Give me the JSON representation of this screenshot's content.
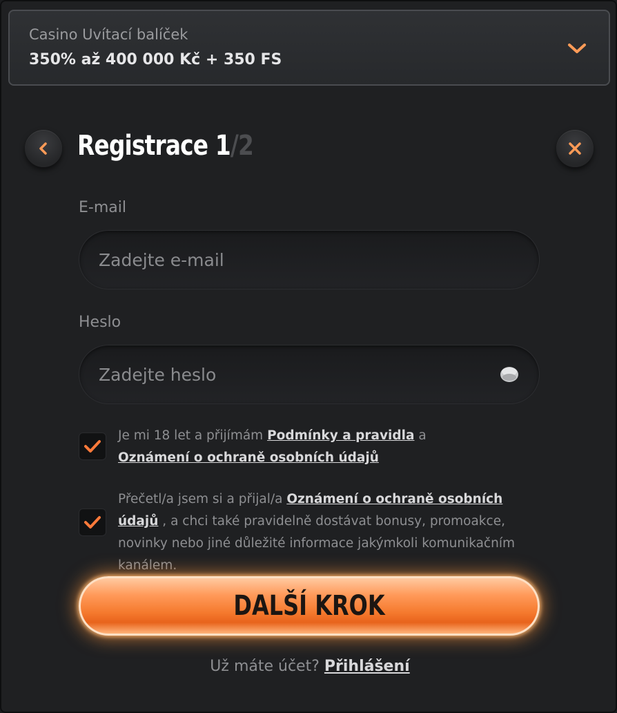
{
  "bonus": {
    "subtitle": "Casino Uvítací balíček",
    "title": "350% až 400 000 Kč + 350 FS",
    "chevron_icon": "chevron-down-icon"
  },
  "header": {
    "title": "Registrace 1",
    "step_total": "/2",
    "back_icon": "chevron-left-icon",
    "close_icon": "close-icon"
  },
  "form": {
    "email": {
      "label": "E-mail",
      "placeholder": "Zadejte e-mail",
      "value": ""
    },
    "password": {
      "label": "Heslo",
      "placeholder": "Zadejte heslo",
      "value": "",
      "toggle_icon": "eye-icon"
    }
  },
  "consents": [
    {
      "checked": true,
      "text_before": "Je mi 18 let a přijímám ",
      "link1": "Podmínky a pravidla",
      "text_middle": " a ",
      "link2": "Oznámení o ochraně osobních údajů",
      "text_after": ""
    },
    {
      "checked": true,
      "text_before": "Přečetl/a jsem si a přijal/a ",
      "link1": "Oznámení o ochraně osobních údajů",
      "text_after": " , a chci také pravidelně dostávat bonusy, promoakce, novinky nebo jiné důležité informace jakýmkoli komunikačním kanálem."
    }
  ],
  "cta": {
    "label": "DALŠÍ KROK"
  },
  "login": {
    "prompt": "Už máte účet? ",
    "link": "Přihlášení"
  },
  "colors": {
    "accent": "#f57a2e",
    "background": "#1f2022",
    "check": "#ff7a3a"
  }
}
